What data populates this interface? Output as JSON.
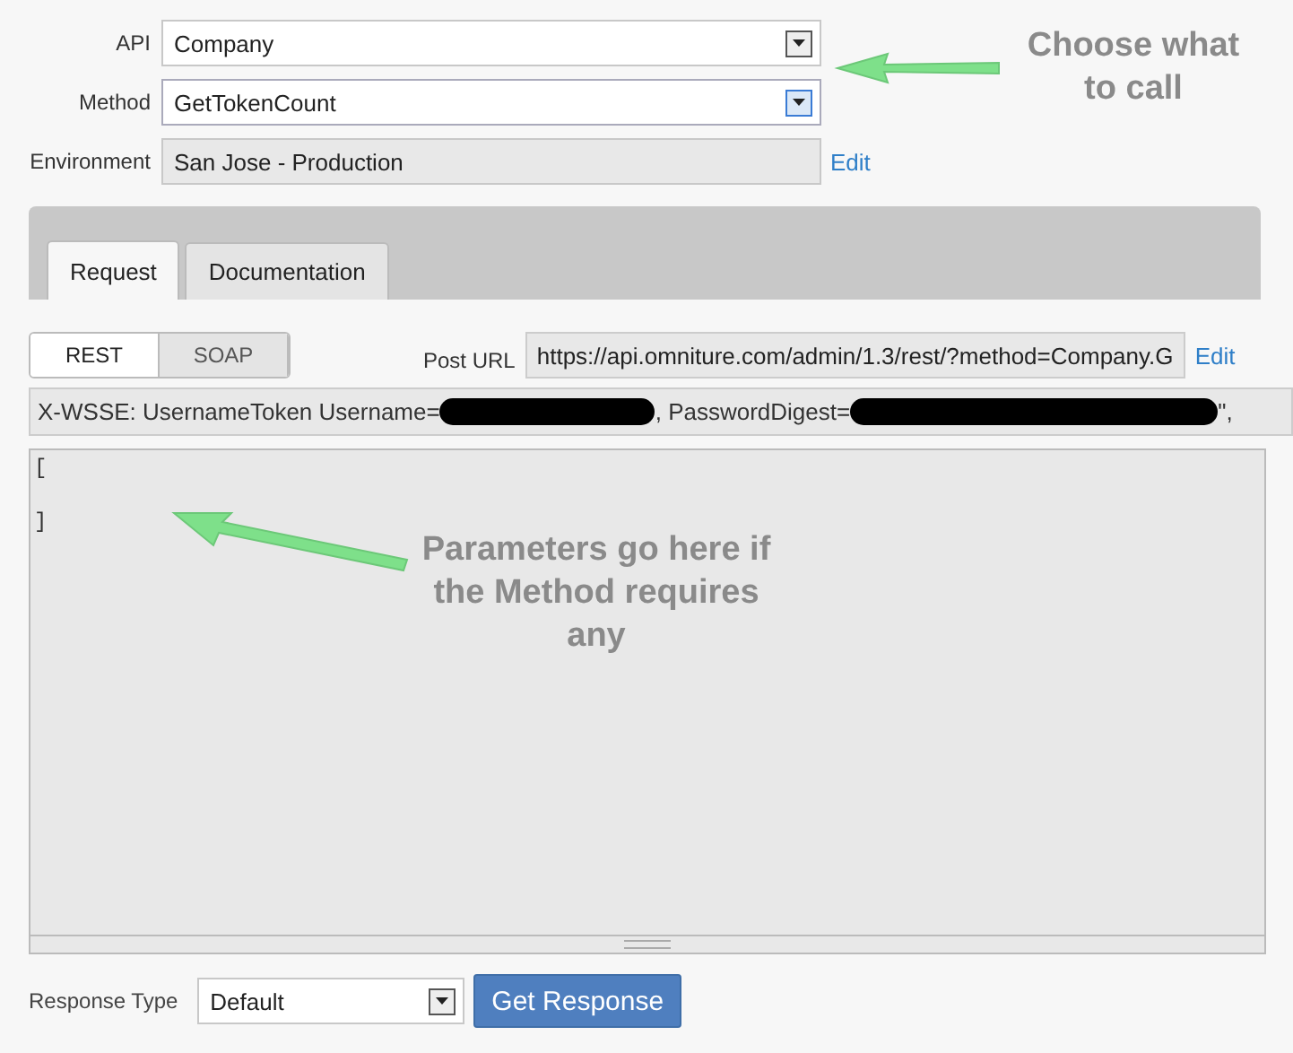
{
  "fields": [
    {
      "label": "API",
      "kind": "select",
      "value": "Company",
      "focused": false
    },
    {
      "label": "Method",
      "kind": "select",
      "value": "GetTokenCount",
      "focused": true
    },
    {
      "label": "Environment",
      "kind": "readonly",
      "value": "San Jose - Production",
      "link": "Edit"
    }
  ],
  "annotations": [
    {
      "text": "Choose what to call"
    },
    {
      "text": "Parameters go here if the Method requires any"
    }
  ],
  "tabs": [
    {
      "label": "Request",
      "selected": true
    },
    {
      "label": "Documentation",
      "selected": false
    }
  ],
  "format_toggle": [
    {
      "label": "REST",
      "selected": true
    },
    {
      "label": "SOAP",
      "selected": false
    }
  ],
  "post_url": {
    "label": "Post URL",
    "value": "https://api.omniture.com/admin/1.3/rest/?method=Company.G",
    "link": "Edit"
  },
  "header_line": {
    "parts": [
      "X-WSSE: UsernameToken Username=",
      ", PasswordDigest=",
      "\","
    ]
  },
  "body": {
    "lines": [
      "[",
      "]"
    ]
  },
  "response_type": {
    "label": "Response Type",
    "value": "Default"
  },
  "submit": "Get Response"
}
